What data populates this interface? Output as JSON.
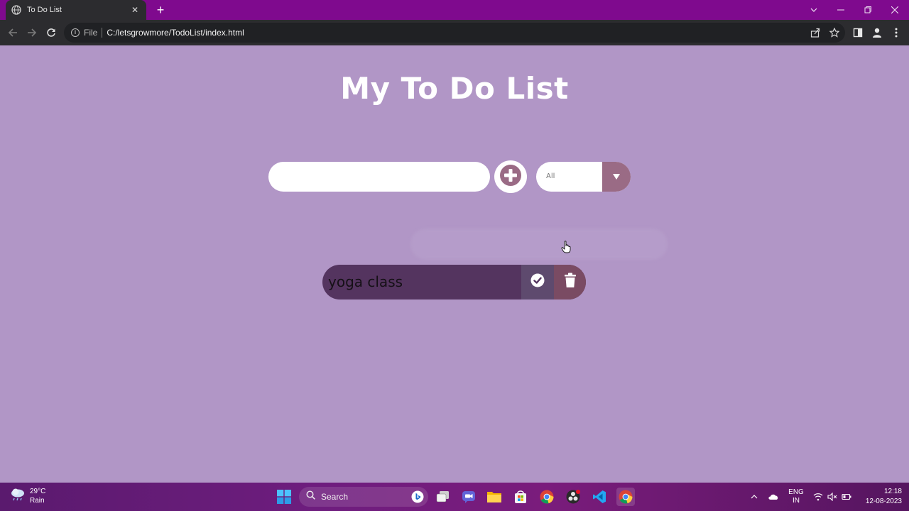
{
  "browser": {
    "tab_title": "To Do List",
    "url_scheme": "File",
    "url": "C:/letsgrowmore/TodoList/index.html"
  },
  "page": {
    "title": "My To Do List",
    "input": {
      "value": "",
      "placeholder": ""
    },
    "filter": {
      "selected": "All"
    },
    "todos": [
      {
        "text": "yoga class"
      }
    ]
  },
  "taskbar": {
    "weather_temp": "29°C",
    "weather_desc": "Rain",
    "search_label": "Search",
    "lang_1": "ENG",
    "lang_2": "IN",
    "time": "12:18",
    "date": "12-08-2023"
  },
  "colors": {
    "page_bg": "#b196c6",
    "tabbar_bg": "#7f0a8e",
    "item_bg": "#54345f",
    "filter_arrow_bg": "#9a6b85",
    "add_icon": "#9a6b85"
  }
}
